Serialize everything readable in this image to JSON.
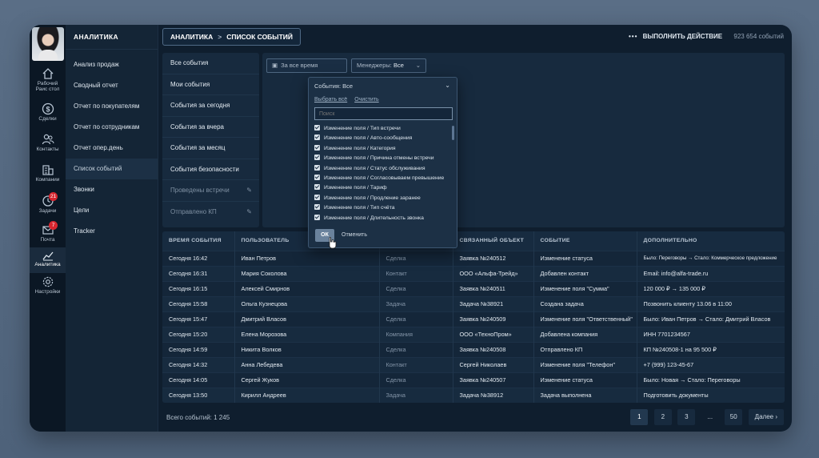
{
  "rail": [
    {
      "icon": "home-icon",
      "label": "Рабочий\nРаис стол",
      "badge": ""
    },
    {
      "icon": "deals-icon",
      "label": "Сделки",
      "badge": ""
    },
    {
      "icon": "contacts-icon",
      "label": "Контакты",
      "badge": ""
    },
    {
      "icon": "company-icon",
      "label": "Компании",
      "badge": ""
    },
    {
      "icon": "tasks-icon",
      "label": "Задачи",
      "badge": "21"
    },
    {
      "icon": "mail-icon",
      "label": "Почта",
      "badge": "7"
    },
    {
      "icon": "analytics-icon",
      "label": "Аналитика",
      "badge": ""
    },
    {
      "icon": "settings-icon",
      "label": "Настройки",
      "badge": ""
    }
  ],
  "rail_home_label": "Рабочий Раис стол",
  "menu": {
    "title": "АНАЛИТИКА",
    "items": [
      "Анализ продаж",
      "Сводный отчет",
      "Отчет по покупателям",
      "Отчет по сотрудникам",
      "Отчет опер.день",
      "Список событий",
      "Звонки",
      "Цели",
      "Tracker"
    ],
    "active_index": 5
  },
  "breadcrumb": {
    "root": "АНАЛИТИКА",
    "sep": ">",
    "current": "СПИСОК СОБЫТИЙ"
  },
  "topright": {
    "dots": "•••",
    "action": "ВЫПОЛНИТЬ ДЕЙСТВИЕ",
    "count": "923 654 событий"
  },
  "views": {
    "items": [
      "Все события",
      "Мои события",
      "События за сегодня",
      "События за вчера",
      "События за месяц",
      "События безопасности"
    ],
    "dim_items": [
      "Проведены встречи",
      "Отправлено КП"
    ]
  },
  "filters": {
    "period": "За все время",
    "managers_label": "Менеджеры:",
    "managers_value": "Все"
  },
  "dropdown": {
    "header": "События: Все",
    "select_all": "Выбрать всё",
    "clear": "Очистить",
    "search_placeholder": "Поиск",
    "items": [
      "Изменение поля / Тип встречи",
      "Изменение поля / Авто-сообщения",
      "Изменение поля / Категория",
      "Изменение поля / Причина отмены встречи",
      "Изменение поля / Статус обслуживания",
      "Изменение поля / Согласовываем превышение",
      "Изменение поля / Тариф",
      "Изменение поля / Продление заранее",
      "Изменение поля / Тип счёта",
      "Изменение поля / Длительность звонка"
    ],
    "ok": "ОК",
    "cancel": "Отменить"
  },
  "table": {
    "columns": [
      "ВРЕМЯ СОБЫТИЯ",
      "ПОЛЬЗОВАТЕЛЬ",
      "",
      "СВЯЗАННЫЙ ОБЪЕКТ",
      "СОБЫТИЕ",
      "ДОПОЛНИТЕЛЬНО"
    ],
    "rows": [
      [
        "Сегодня 16:42",
        "Иван Петров",
        "Сделка",
        "Заявка №240512",
        "Изменение статуса",
        "Было: Переговоры → Стало: Коммерческое предложение"
      ],
      [
        "Сегодня 16:31",
        "Мария Соколова",
        "Контакт",
        "ООО «Альфа-Трейд»",
        "Добавлен контакт",
        "Email: info@alfa-trade.ru"
      ],
      [
        "Сегодня 16:15",
        "Алексей Смирнов",
        "Сделка",
        "Заявка №240511",
        "Изменение поля \"Сумма\"",
        "120 000 ₽ → 135 000 ₽"
      ],
      [
        "Сегодня 15:58",
        "Ольга Кузнецова",
        "Задача",
        "Задача №38921",
        "Создана задача",
        "Позвонить клиенту 13.06 в 11:00"
      ],
      [
        "Сегодня 15:47",
        "Дмитрий Власов",
        "Сделка",
        "Заявка №240509",
        "Изменение поля \"Ответственный\"",
        "Было: Иван Петров → Стало: Дмитрий Власов"
      ],
      [
        "Сегодня 15:20",
        "Елена Морозова",
        "Компания",
        "ООО «ТехноПром»",
        "Добавлена компания",
        "ИНН 7701234567"
      ],
      [
        "Сегодня 14:59",
        "Никита Волков",
        "Сделка",
        "Заявка №240508",
        "Отправлено КП",
        "КП №240508-1 на 95 500 ₽"
      ],
      [
        "Сегодня 14:32",
        "Анна Лебедева",
        "Контакт",
        "Сергей Николаев",
        "Изменение поля \"Телефон\"",
        "+7 (999) 123-45-67"
      ],
      [
        "Сегодня 14:05",
        "Сергей Жуков",
        "Сделка",
        "Заявка №240507",
        "Изменение статуса",
        "Было: Новая → Стало: Переговоры"
      ],
      [
        "Сегодня 13:50",
        "Кирилл Андреев",
        "Задача",
        "Задача №38912",
        "Задача выполнена",
        "Подготовить документы"
      ]
    ]
  },
  "footer": {
    "total": "Всего событий: 1 245",
    "pages": [
      "1",
      "2",
      "3",
      "...",
      "50"
    ],
    "next": "Далее ›",
    "active_page": "1"
  },
  "colors": {
    "bg": "#0f1e2e",
    "panel": "#172a3e",
    "badge": "#d8262f",
    "accent": "#6a829c"
  }
}
